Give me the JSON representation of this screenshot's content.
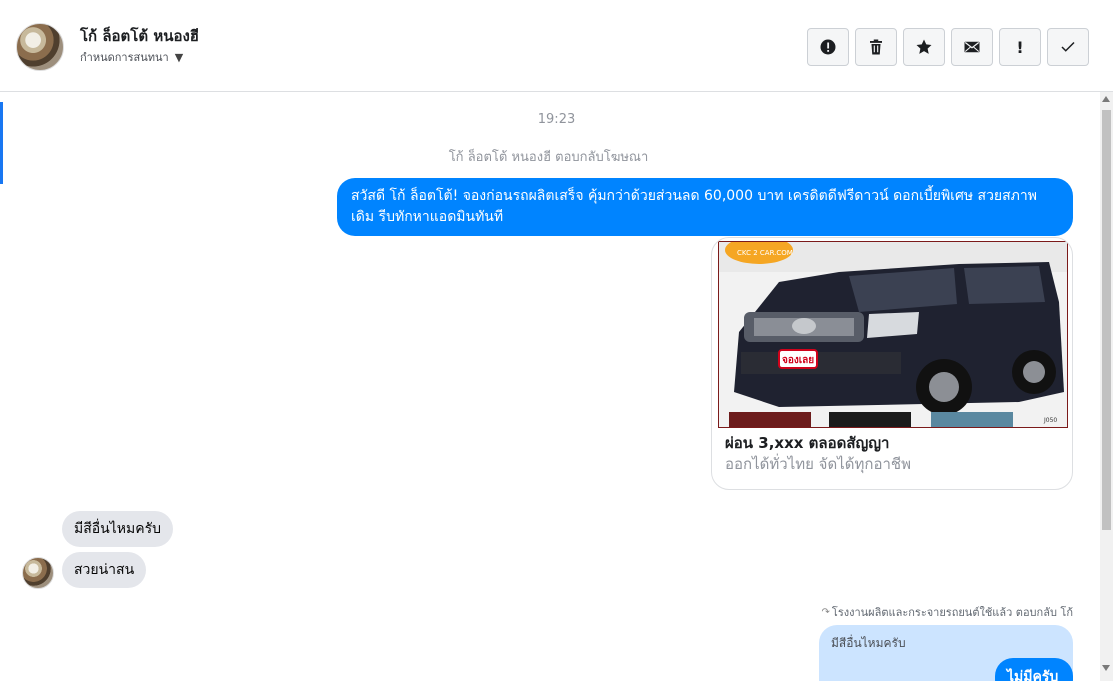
{
  "header": {
    "contact_name": "โก้ ล็อตโต้ หนองฮี",
    "conversation_setting": "กำหนดการสนทนา",
    "toolbar": [
      {
        "name": "alert-icon",
        "label": "!"
      },
      {
        "name": "trash-icon",
        "label": ""
      },
      {
        "name": "star-icon",
        "label": ""
      },
      {
        "name": "mail-icon",
        "label": ""
      },
      {
        "name": "exclamation-icon",
        "label": "!"
      },
      {
        "name": "check-icon",
        "label": ""
      }
    ]
  },
  "chat": {
    "timestamp": "19:23",
    "system_note": "โก้ ล็อตโต้ หนองฮี ตอบกลับโฆษณา",
    "outgoing_message": "สวัสดี โก้ ล็อตโต้! จองก่อนรถผลิตเสร็จ คุ้มกว่าด้วยส่วนลด 60,000 บาท เครดิตดีฟรีดาวน์ ดอกเบี้ยพิเศษ สวยสภาพเดิม รีบทักหาแอดมินทันที",
    "ad_card": {
      "title": "ผ่อน 3,xxx ตลอดสัญญา",
      "subtitle": "ออกได้ทั่วไทย จัดได้ทุกอาชีพ",
      "image_badge": "จองเลย",
      "image_logo": "CKC 2 CAR.COM",
      "image_code": "J050"
    },
    "incoming_messages": [
      {
        "text": "มีสีอื่นไหมครับ"
      },
      {
        "text": "สวยน่าสน"
      }
    ],
    "reply_note": "โรงงานผลิตและกระจายรถยนต์ใช้แล้ว ตอบกลับ โก้",
    "quoted_text": "มีสีอื่นไหมครับ",
    "reply_text": "ไม่มีครับ"
  },
  "colors": {
    "outgoing_bubble": "#0084ff",
    "incoming_bubble": "#e4e6eb",
    "quoted_bubble": "#cce4ff",
    "accent": "#1877f2"
  }
}
